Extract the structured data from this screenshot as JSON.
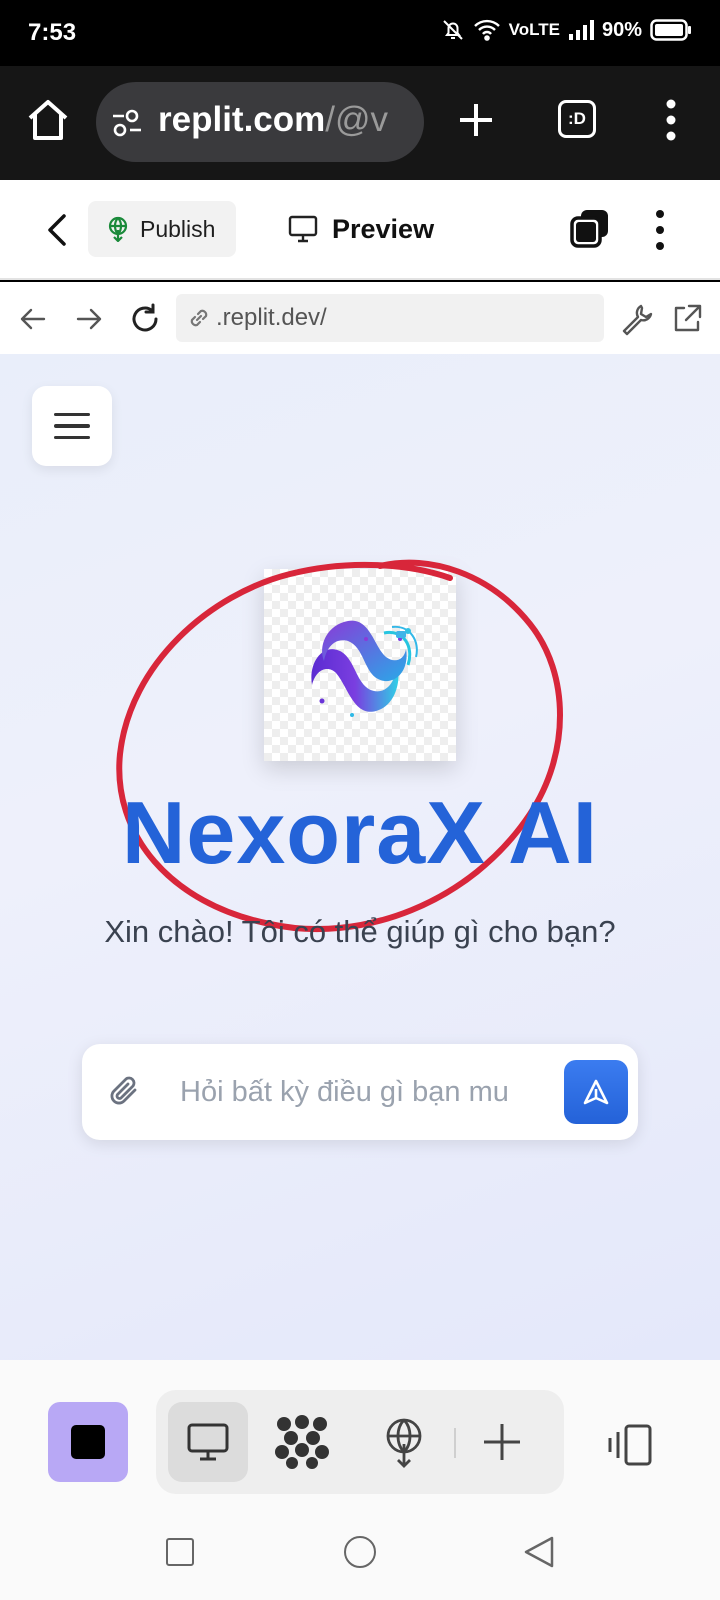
{
  "status_bar": {
    "time": "7:53",
    "network": "VoLTE",
    "battery": "90%",
    "icons": [
      "bell-off-icon",
      "wifi-icon",
      "signal-icon",
      "battery-icon"
    ]
  },
  "browser": {
    "url_host": "replit.com",
    "url_path": "/@v",
    "tabs_label": ":D"
  },
  "replit_bar": {
    "publish_label": "Publish",
    "preview_label": "Preview"
  },
  "preview_bar": {
    "url": ".replit.dev/"
  },
  "app": {
    "title": "NexoraX AI",
    "greeting": "Xin chào! Tôi có thể giúp gì cho bạn?",
    "input_placeholder": "Hỏi bất kỳ điều gì bạn mu",
    "accent_color": "#2463d8",
    "annotation_color": "#d8263a"
  }
}
